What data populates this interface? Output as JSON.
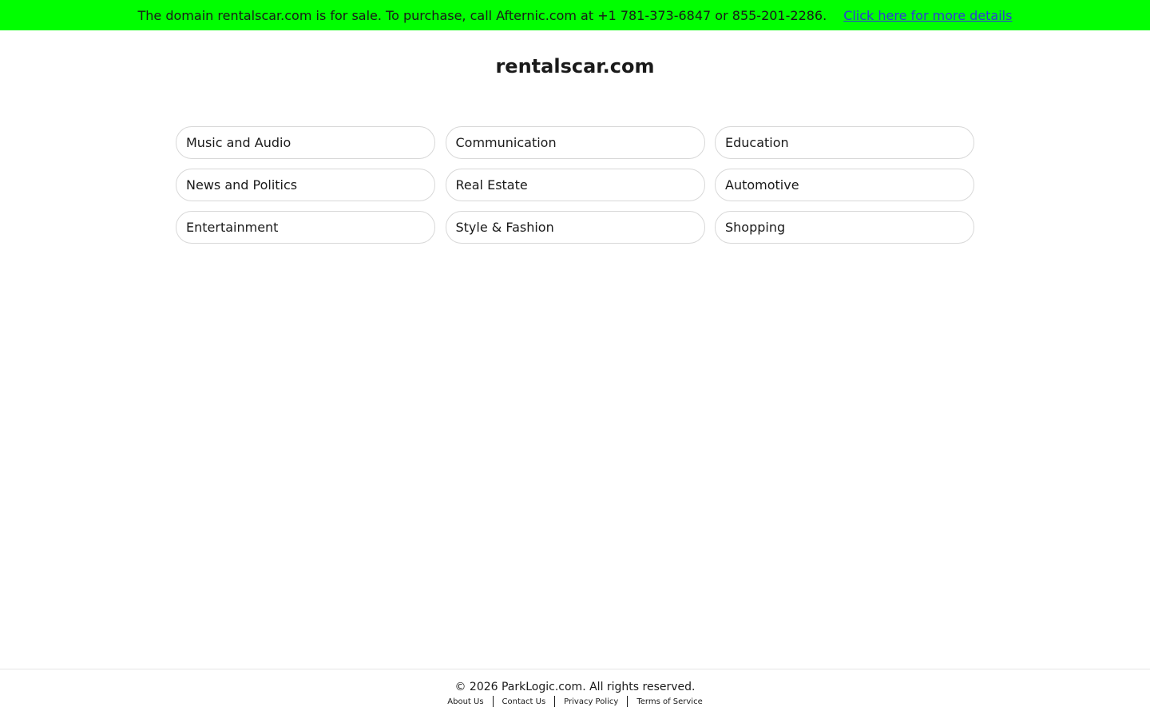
{
  "banner": {
    "message": "The domain rentalscar.com is for sale. To purchase, call Afternic.com at +1 781-373-6847 or 855-201-2286.",
    "link_label": "Click here for more details",
    "background_color": "#00ff00"
  },
  "site": {
    "title": "rentalscar.com"
  },
  "categories": [
    "Music and Audio",
    "Communication",
    "Education",
    "News and Politics",
    "Real Estate",
    "Automotive",
    "Entertainment",
    "Style & Fashion",
    "Shopping"
  ],
  "footer": {
    "copyright": "© 2026 ParkLogic.com. All rights reserved.",
    "links": [
      "About Us",
      "Contact Us",
      "Privacy Policy",
      "Terms of Service"
    ]
  }
}
